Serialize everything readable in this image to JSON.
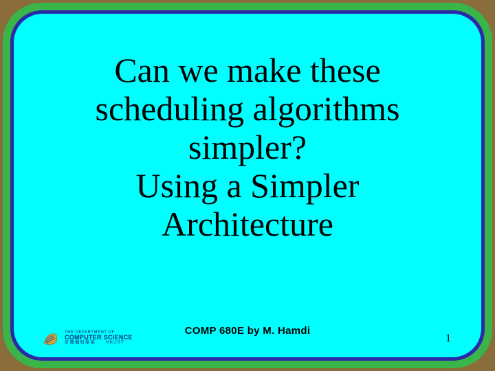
{
  "slide": {
    "title_line1": "Can we make these",
    "title_line2": "scheduling algorithms",
    "title_line3": "simpler?",
    "title_line4": "Using a Simpler",
    "title_line5": "Architecture"
  },
  "footer": {
    "dept_small": "THE DEPARTMENT OF",
    "dept_cs": "COMPUTER SCIENCE",
    "dept_sub": "計算機科學系　　HKUST",
    "center_text": "COMP 680E by M. Hamdi",
    "page_number": "1"
  },
  "colors": {
    "outer": "#8a6d3b",
    "frame": "#39b54a",
    "stroke": "#2a2aa8",
    "bg": "#00ffff"
  }
}
